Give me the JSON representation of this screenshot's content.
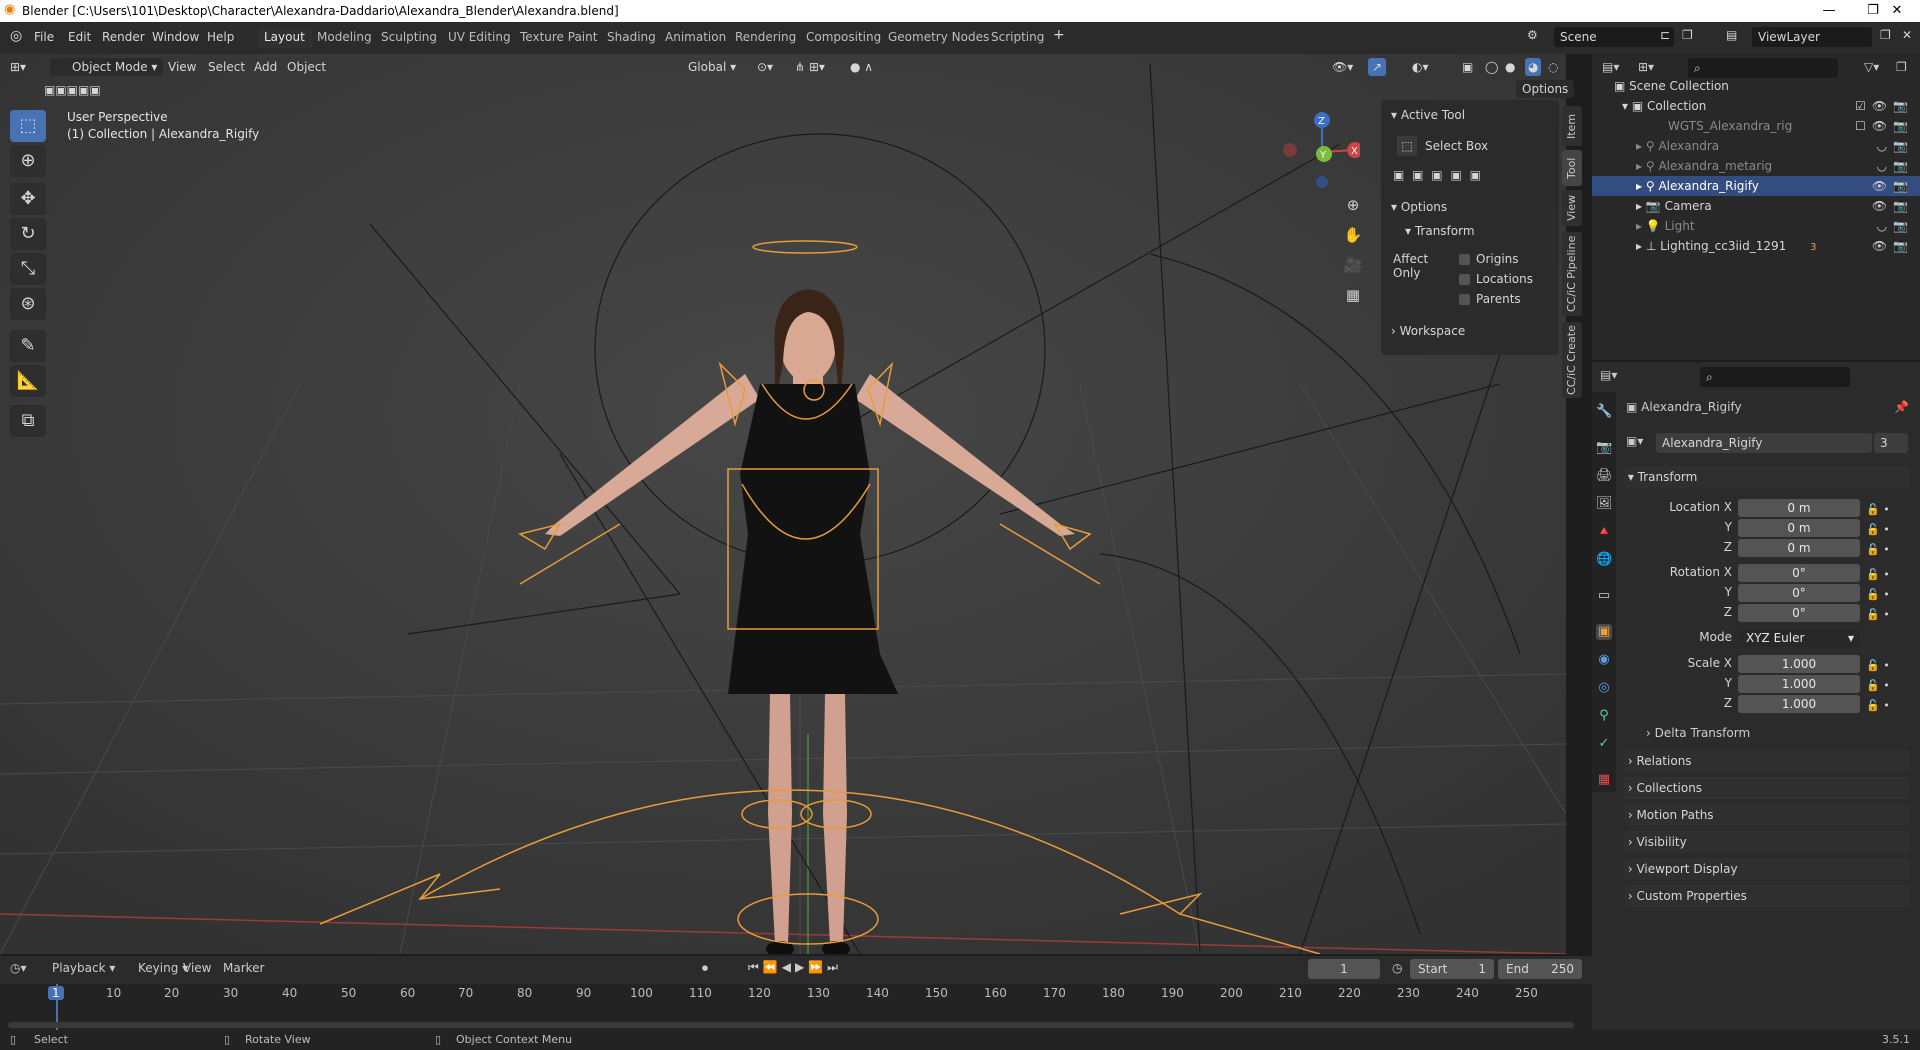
{
  "window": {
    "title": "Blender [C:\\Users\\101\\Desktop\\Character\\Alexandra-Daddario\\Alexandra_Blender\\Alexandra.blend]",
    "minimize": "—",
    "maximize": "❐",
    "close": "✕"
  },
  "menu": [
    "File",
    "Edit",
    "Render",
    "Window",
    "Help"
  ],
  "workspaces": [
    "Layout",
    "Modeling",
    "Sculpting",
    "UV Editing",
    "Texture Paint",
    "Shading",
    "Animation",
    "Rendering",
    "Compositing",
    "Geometry Nodes",
    "Scripting"
  ],
  "scene": {
    "label": "Scene",
    "view_layer": "ViewLayer"
  },
  "viewport_header": {
    "mode": "Object Mode",
    "view": "View",
    "select": "Select",
    "add": "Add",
    "object": "Object",
    "orientation": "Global",
    "options": "Options"
  },
  "viewport": {
    "perspective": "User Perspective",
    "collection_info": "(1) Collection | Alexandra_Rigify"
  },
  "gizmo": {
    "z": "Z",
    "y": "Y",
    "x": "X"
  },
  "npanel": {
    "active_tool": "Active Tool",
    "tool_name": "Select Box",
    "options": "Options",
    "transform": "Transform",
    "affect_only": "Affect Only",
    "origins": "Origins",
    "locations": "Locations",
    "parents": "Parents",
    "workspace": "Workspace"
  },
  "side_tabs": [
    "Item",
    "Tool",
    "View",
    "CC/iC Pipeline",
    "CC/iC Create"
  ],
  "outliner": {
    "root": "Scene Collection",
    "collection": "Collection",
    "items": [
      {
        "name": "WGTS_Alexandra_rig",
        "dim": true
      },
      {
        "name": "Alexandra",
        "dim": true
      },
      {
        "name": "Alexandra_metarig",
        "dim": true
      },
      {
        "name": "Alexandra_Rigify",
        "selected": true
      },
      {
        "name": "Camera"
      },
      {
        "name": "Light",
        "dim": true
      },
      {
        "name": "Lighting_cc3iid_1291",
        "badge": "3"
      }
    ]
  },
  "properties": {
    "object_name": "Alexandra_Rigify",
    "data_name": "Alexandra_Rigify",
    "user_count": "3",
    "transform": "Transform",
    "location_x_label": "Location X",
    "location_x": "0 m",
    "location_y_label": "Y",
    "location_y": "0 m",
    "location_z_label": "Z",
    "location_z": "0 m",
    "rotation_x_label": "Rotation X",
    "rotation_x": "0°",
    "rotation_y_label": "Y",
    "rotation_y": "0°",
    "rotation_z_label": "Z",
    "rotation_z": "0°",
    "mode_label": "Mode",
    "mode": "XYZ Euler",
    "scale_x_label": "Scale X",
    "scale_x": "1.000",
    "scale_y_label": "Y",
    "scale_y": "1.000",
    "scale_z_label": "Z",
    "scale_z": "1.000",
    "delta_transform": "Delta Transform",
    "sections": [
      "Relations",
      "Collections",
      "Motion Paths",
      "Visibility",
      "Viewport Display",
      "Custom Properties"
    ]
  },
  "timeline": {
    "playback": "Playback",
    "keying": "Keying",
    "view": "View",
    "marker": "Marker",
    "current_frame": "1",
    "start_label": "Start",
    "start": "1",
    "end_label": "End",
    "end": "250",
    "ticks": [
      "1",
      "10",
      "20",
      "30",
      "40",
      "50",
      "60",
      "70",
      "80",
      "90",
      "100",
      "110",
      "120",
      "130",
      "140",
      "150",
      "160",
      "170",
      "180",
      "190",
      "200",
      "210",
      "220",
      "230",
      "240",
      "250"
    ]
  },
  "statusbar": {
    "select": "Select",
    "rotate": "Rotate View",
    "context": "Object Context Menu",
    "version": "3.5.1"
  },
  "colors": {
    "accent": "#4772b3",
    "selection": "#e89b3a",
    "header": "#2b2b2b",
    "viewport": "#3c3c3c"
  }
}
